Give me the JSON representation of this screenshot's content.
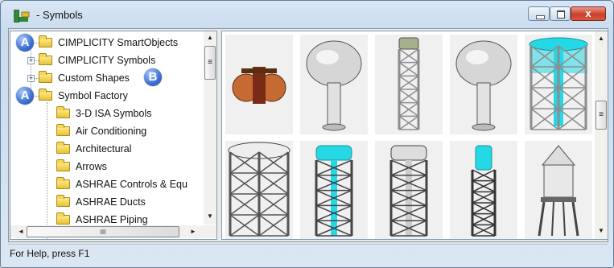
{
  "window": {
    "title": "- Symbols",
    "close_glyph": "x"
  },
  "icons": {
    "app": "app-icon",
    "minimize": "minimize-icon",
    "maximize": "maximize-icon",
    "close": "close-icon"
  },
  "tree": {
    "items": [
      {
        "label": "CIMPLICITY SmartObjects",
        "badge": "A"
      },
      {
        "label": "CIMPLICITY Symbols"
      },
      {
        "label": "Custom Shapes",
        "badge": "B"
      },
      {
        "label": "Symbol Factory",
        "badge": "A"
      },
      {
        "label": "3-D ISA Symbols"
      },
      {
        "label": "Air Conditioning"
      },
      {
        "label": "Architectural"
      },
      {
        "label": "Arrows"
      },
      {
        "label": "ASHRAE Controls & Equ"
      },
      {
        "label": "ASHRAE Ducts"
      },
      {
        "label": "ASHRAE Piping"
      }
    ],
    "scroll_up": "▲",
    "scroll_down": "▼",
    "scroll_left": "◄",
    "scroll_right": "►",
    "hthumb_grip": "III",
    "vthumb_grip": "≡"
  },
  "gallery": {
    "symbols": [
      "twin-spherical-tanks",
      "water-tower-globe",
      "lattice-water-tower",
      "water-tower-globe-2",
      "cyan-lattice-tank",
      "lattice-tank-grey",
      "cyan-lattice-tower",
      "lattice-tower-grey",
      "cyan-tall-lattice-tower",
      "wooden-water-tower"
    ],
    "scroll_up": "▲",
    "scroll_down": "▼",
    "vthumb_grip": "≡"
  },
  "colors": {
    "cyan": "#25d8e6",
    "copper": "#c56a32",
    "steel": "#8d8d8d",
    "badge": "#3d6fd0"
  },
  "status": {
    "text": "For Help, press F1"
  }
}
